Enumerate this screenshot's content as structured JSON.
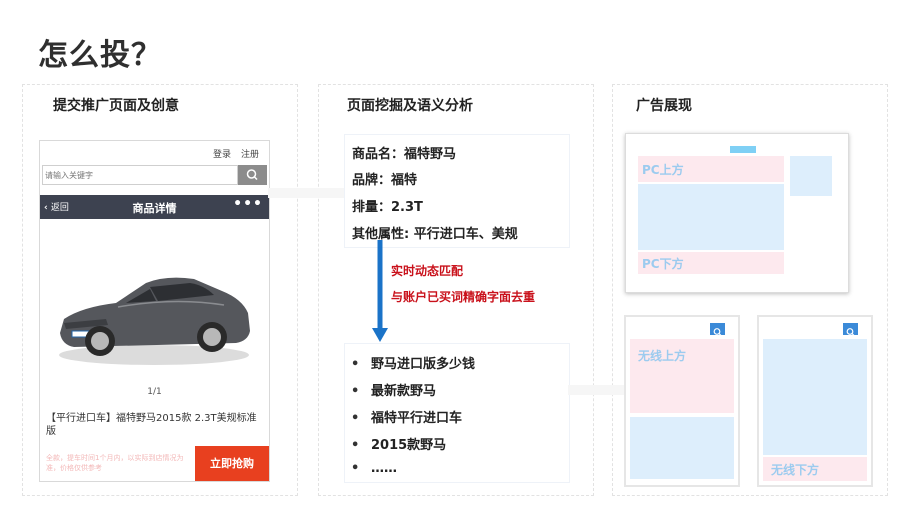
{
  "title": "怎么投？",
  "columns": {
    "submit": "提交推广页面及创意",
    "analyze": "页面挖掘及语义分析",
    "display": "广告展现"
  },
  "phone": {
    "login": "登录",
    "register": "注册",
    "search_placeholder": "请输入关键字",
    "back": "返回",
    "nav_title": "商品详情",
    "more": "•••",
    "page_indicator": "1/1",
    "description": "【平行进口车】福特野马2015款 2.3T美规标准版",
    "faded_text": "全款，提车时间1个月内，以实际到店情况为准，价格仅供参考",
    "buy_button": "立即抢购"
  },
  "attributes": [
    "商品名：福特野马",
    "品牌：福特",
    "排量：2.3T",
    "其他属性: 平行进口车、美规"
  ],
  "process_notes": [
    "实时动态匹配",
    "与账户已买词精确字面去重"
  ],
  "keyword_bullet": "•",
  "keywords": [
    "野马进口版多少钱",
    "最新款野马",
    "福特平行进口车",
    "2015款野马",
    "……"
  ],
  "ad_labels": {
    "pc_top": "PC上方",
    "pc_bottom": "PC下方",
    "mobile_top": "无线上方",
    "mobile_bottom": "无线下方"
  },
  "colors": {
    "arrow_blue": "#1a73c8",
    "highlight_red": "#c9111b",
    "buy_button": "#e8401f",
    "ad_pink": "#fde9ee",
    "ad_blue": "#ddeefc",
    "ad_label": "#9ccbef"
  }
}
